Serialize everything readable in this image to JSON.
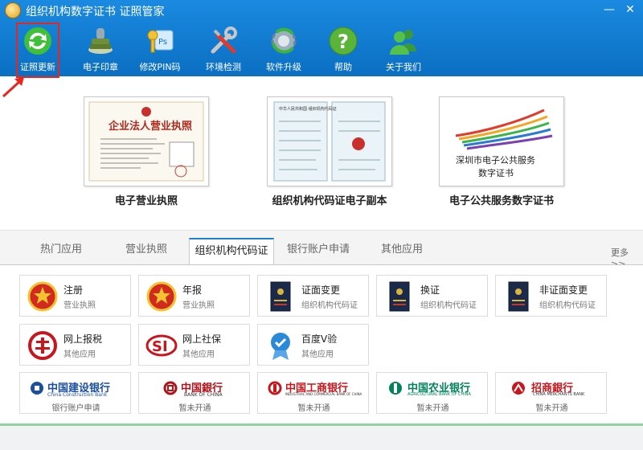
{
  "window": {
    "title": "组织机构数字证书  证照管家",
    "minimize_glyph": "—",
    "close_glyph": "✕"
  },
  "toolbar": {
    "items": [
      {
        "label": "证照更新",
        "icon": "refresh-icon"
      },
      {
        "label": "电子印章",
        "icon": "stamp-icon"
      },
      {
        "label": "修改PIN码",
        "icon": "key-icon"
      },
      {
        "label": "环境检测",
        "icon": "tools-icon"
      },
      {
        "label": "软件升级",
        "icon": "upgrade-gear-icon"
      },
      {
        "label": "帮助",
        "icon": "help-icon"
      },
      {
        "label": "关于我们",
        "icon": "users-icon"
      }
    ],
    "selected": "证照更新"
  },
  "certificates": [
    {
      "label": "电子营业执照",
      "image_text": "企业法人营业执照"
    },
    {
      "label": "组织机构代码证电子副本",
      "image_text": "中华人民共和国 组织机构代码证"
    },
    {
      "label": "电子公共服务数字证书",
      "image_text": "深圳市电子公共服务 数字证书"
    }
  ],
  "tabs": {
    "items": [
      "热门应用",
      "营业执照",
      "组织机构代码证",
      "银行账户申请",
      "其他应用"
    ],
    "active": "组织机构代码证",
    "more": "更多>>"
  },
  "apps_row1": [
    {
      "title": "注册",
      "subtitle": "营业执照",
      "icon": "national-emblem-icon"
    },
    {
      "title": "年报",
      "subtitle": "营业执照",
      "icon": "national-emblem-icon"
    },
    {
      "title": "证面变更",
      "subtitle": "组织机构代码证",
      "icon": "certificate-book-icon"
    },
    {
      "title": "换证",
      "subtitle": "组织机构代码证",
      "icon": "certificate-book-icon"
    },
    {
      "title": "非证面变更",
      "subtitle": "组织机构代码证",
      "icon": "certificate-book-icon"
    }
  ],
  "apps_row2": [
    {
      "title": "网上报税",
      "subtitle": "其他应用",
      "icon": "tax-icon"
    },
    {
      "title": "网上社保",
      "subtitle": "其他应用",
      "icon": "social-security-icon"
    },
    {
      "title": "百度V验",
      "subtitle": "其他应用",
      "icon": "baidu-verify-icon"
    }
  ],
  "banks": [
    {
      "name": "中国建设银行",
      "name_en": "China Construction Bank",
      "status": "银行账户申请",
      "color": "#1a4fa0"
    },
    {
      "name": "中国銀行",
      "name_en": "BANK OF CHINA",
      "status": "暂未开通",
      "color": "#b01218"
    },
    {
      "name": "中国工商银行",
      "name_en": "INDUSTRIAL AND COMMERCIAL BANK OF CHINA",
      "status": "暂未开通",
      "color": "#c8161d"
    },
    {
      "name": "中国农业银行",
      "name_en": "AGRICULTURAL BANK OF CHINA",
      "status": "暂未开通",
      "color": "#00835a"
    },
    {
      "name": "招商銀行",
      "name_en": "CHINA MERCHANTS BANK",
      "status": "暂未开通",
      "color": "#c8161d"
    }
  ],
  "colors": {
    "toolbar_bg": "#0b6fc2",
    "selection_highlight": "#e8251f",
    "active_tab_accent": "#1f7ed6"
  }
}
